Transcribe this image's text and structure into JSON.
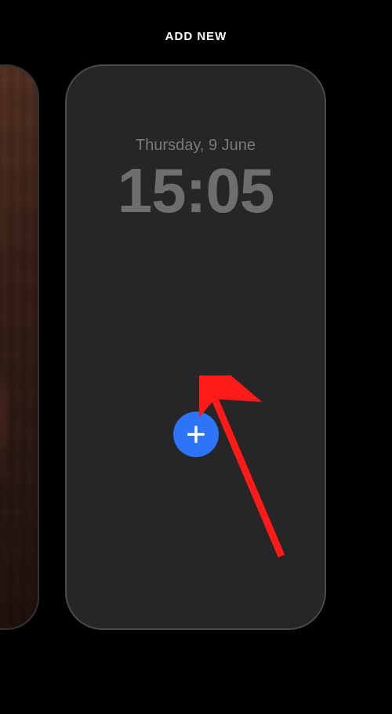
{
  "header": {
    "title": "ADD NEW"
  },
  "lockscreen": {
    "date": "Thursday, 9 June",
    "time": "15:05"
  },
  "colors": {
    "accent": "#2d74f6",
    "annotation": "#ff1a1a"
  }
}
